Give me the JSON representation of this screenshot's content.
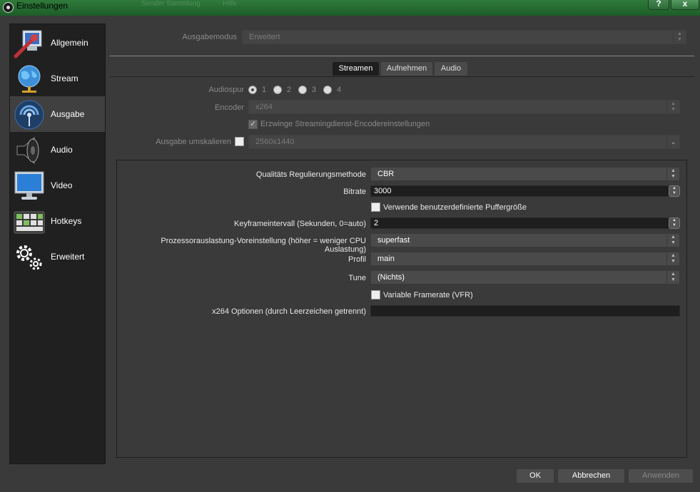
{
  "window": {
    "title": "Einstellungen",
    "help_label": "?",
    "close_label": "x"
  },
  "background_ghost": [
    "Sender Sammlung",
    "Hilfe"
  ],
  "sidebar": {
    "items": [
      {
        "label": "Allgemein",
        "icon": "wrench-monitor-icon"
      },
      {
        "label": "Stream",
        "icon": "globe-icon"
      },
      {
        "label": "Ausgabe",
        "icon": "broadcast-icon"
      },
      {
        "label": "Audio",
        "icon": "speaker-icon"
      },
      {
        "label": "Video",
        "icon": "monitor-icon"
      },
      {
        "label": "Hotkeys",
        "icon": "keyboard-icon"
      },
      {
        "label": "Erweitert",
        "icon": "gears-icon"
      }
    ],
    "selected": "Ausgabe"
  },
  "output_mode": {
    "label": "Ausgabemodus",
    "value": "Erweitert"
  },
  "tabs": [
    {
      "label": "Streamen",
      "active": true
    },
    {
      "label": "Aufnehmen",
      "active": false
    },
    {
      "label": "Audio",
      "active": false
    }
  ],
  "streaming": {
    "audio_track": {
      "label": "Audiospur",
      "options": [
        "1",
        "2",
        "3",
        "4"
      ],
      "selected": "1"
    },
    "encoder": {
      "label": "Encoder",
      "value": "x264"
    },
    "enforce": {
      "label": "Erzwinge Streamingdienst-Encodereinstellungen",
      "checked": true
    },
    "rescale": {
      "label": "Ausgabe umskalieren",
      "checked": false,
      "value": "2560x1440"
    }
  },
  "encoder_settings": {
    "rate_control": {
      "label": "Qualitäts Regulierungsmethode",
      "value": "CBR"
    },
    "bitrate": {
      "label": "Bitrate",
      "value": "3000"
    },
    "custom_buffer": {
      "label": "Verwende benutzerdefinierte Puffergröße",
      "checked": false
    },
    "keyframe": {
      "label": "Keyframeintervall (Sekunden, 0=auto)",
      "value": "2"
    },
    "preset": {
      "label": "Prozessorauslastung-Voreinstellung (höher = weniger CPU Auslastung)",
      "value": "superfast"
    },
    "profile": {
      "label": "Profil",
      "value": "main"
    },
    "tune": {
      "label": "Tune",
      "value": "(Nichts)"
    },
    "vfr": {
      "label": "Variable Framerate (VFR)",
      "checked": false
    },
    "x264opts": {
      "label": "x264 Optionen (durch Leerzeichen getrennt)",
      "value": ""
    }
  },
  "buttons": {
    "ok": "OK",
    "cancel": "Abbrechen",
    "apply": "Anwenden"
  }
}
